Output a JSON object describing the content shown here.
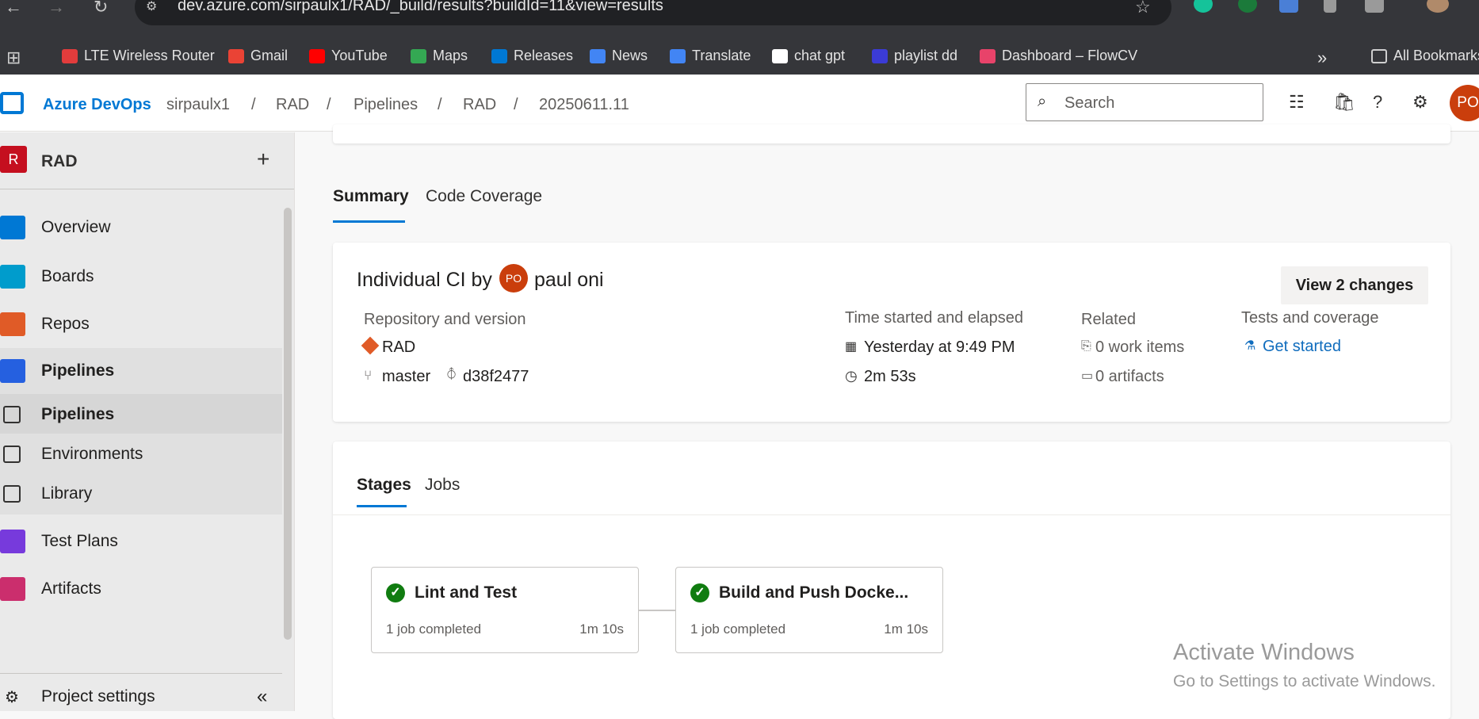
{
  "browser": {
    "url": "dev.azure.com/sirpaulx1/RAD/_build/results?buildId=11&view=results",
    "bookmarks": [
      {
        "label": "LTE Wireless Router",
        "icon": "router-icon",
        "color": "#e23c3c"
      },
      {
        "label": "Gmail",
        "icon": "gmail-icon",
        "color": "#ea4335"
      },
      {
        "label": "YouTube",
        "icon": "youtube-icon",
        "color": "#ff0000"
      },
      {
        "label": "Maps",
        "icon": "maps-icon",
        "color": "#34a853"
      },
      {
        "label": "Releases",
        "icon": "releases-icon",
        "color": "#0078d4"
      },
      {
        "label": "News",
        "icon": "news-icon",
        "color": "#4285f4"
      },
      {
        "label": "Translate",
        "icon": "translate-icon",
        "color": "#4285f4"
      },
      {
        "label": "chat gpt",
        "icon": "chatgpt-icon",
        "color": "#ffffff"
      },
      {
        "label": "playlist dd",
        "icon": "playlist-icon",
        "color": "#3b3bd6"
      },
      {
        "label": "Dashboard – FlowCV",
        "icon": "flowcv-icon",
        "color": "#e8436a"
      }
    ],
    "more_label": "»",
    "all_bookmarks": "All Bookmarks"
  },
  "header": {
    "brand": "Azure DevOps",
    "breadcrumb": [
      "sirpaulx1",
      "RAD",
      "Pipelines",
      "RAD",
      "20250611.11"
    ],
    "separator": "/",
    "search_placeholder": "Search",
    "avatar_initials": "PO"
  },
  "sidebar": {
    "project_initial": "R",
    "project_name": "RAD",
    "add_label": "+",
    "items": [
      {
        "label": "Overview",
        "icon": "overview-icon",
        "color": "#0078d4",
        "bold": false,
        "selected": false
      },
      {
        "label": "Boards",
        "icon": "boards-icon",
        "color": "#009ccc",
        "bold": false,
        "selected": false
      },
      {
        "label": "Repos",
        "icon": "repos-icon",
        "color": "#e05b27",
        "bold": false,
        "selected": false
      },
      {
        "label": "Pipelines",
        "icon": "pipelines-icon",
        "color": "#2560e0",
        "bold": true,
        "selected": false
      },
      {
        "label": "Pipelines",
        "icon": "pipelines-sub-icon",
        "color": "#323130",
        "bold": true,
        "selected": true
      },
      {
        "label": "Environments",
        "icon": "environments-icon",
        "color": "#323130",
        "bold": false,
        "selected": false
      },
      {
        "label": "Library",
        "icon": "library-icon",
        "color": "#323130",
        "bold": false,
        "selected": false
      },
      {
        "label": "Test Plans",
        "icon": "test-plans-icon",
        "color": "#773adc",
        "bold": false,
        "selected": false
      },
      {
        "label": "Artifacts",
        "icon": "artifacts-icon",
        "color": "#cb2e6d",
        "bold": false,
        "selected": false
      }
    ],
    "project_settings": "Project settings",
    "collapse_label": "«"
  },
  "main": {
    "tabs": [
      "Summary",
      "Code Coverage"
    ],
    "run": {
      "title_prefix": "Individual CI by",
      "author_initials": "PO",
      "author": "paul oni",
      "view_changes": "View 2 changes",
      "repo_label": "Repository and version",
      "repo_name": "RAD",
      "branch": "master",
      "commit": "d38f2477",
      "time_label": "Time started and elapsed",
      "started": "Yesterday at 9:49 PM",
      "elapsed": "2m 53s",
      "related_label": "Related",
      "work_items": "0 work items",
      "artifacts": "0 artifacts",
      "tests_label": "Tests and coverage",
      "get_started": "Get started"
    },
    "stage_tabs": [
      "Stages",
      "Jobs"
    ],
    "stages": [
      {
        "name": "Lint and Test",
        "status": "1 job completed",
        "duration": "1m 10s"
      },
      {
        "name": "Build and Push Docke...",
        "status": "1 job completed",
        "duration": "1m 10s"
      }
    ]
  },
  "watermark": {
    "line1": "Activate Windows",
    "line2": "Go to Settings to activate Windows."
  }
}
